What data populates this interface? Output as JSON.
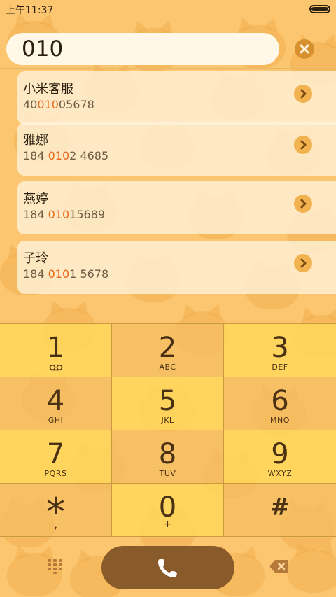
{
  "status": {
    "time": "上午11:37"
  },
  "search": {
    "value": "010"
  },
  "results": [
    {
      "name": "小米客服",
      "num_pre": "40",
      "num_hl": "010",
      "num_post": "05678"
    },
    {
      "name": "雅娜",
      "num_pre": "184 ",
      "num_hl": "010",
      "num_post": "2 4685"
    },
    {
      "name": "燕婷",
      "num_pre": "184 ",
      "num_hl": "010",
      "num_post": "15689"
    },
    {
      "name": "子玲",
      "num_pre": "184 ",
      "num_hl": "010",
      "num_post": "1 5678"
    }
  ],
  "keypad": {
    "k1": {
      "digit": "1",
      "letters": ""
    },
    "k2": {
      "digit": "2",
      "letters": "ABC"
    },
    "k3": {
      "digit": "3",
      "letters": "DEF"
    },
    "k4": {
      "digit": "4",
      "letters": "GHI"
    },
    "k5": {
      "digit": "5",
      "letters": "JKL"
    },
    "k6": {
      "digit": "6",
      "letters": "MNO"
    },
    "k7": {
      "digit": "7",
      "letters": "PQRS"
    },
    "k8": {
      "digit": "8",
      "letters": "TUV"
    },
    "k9": {
      "digit": "9",
      "letters": "WXYZ"
    },
    "kstar": {
      "digit": "*",
      "sub": ","
    },
    "k0": {
      "digit": "0",
      "sub": "+"
    },
    "khash": {
      "digit": "#"
    }
  },
  "icons": {
    "clear": "close-circle-icon",
    "detail": "chevron-right-icon",
    "call": "phone-icon",
    "dialpad": "dialpad-grid-icon",
    "backspace": "backspace-icon",
    "voicemail": "voicemail-icon",
    "battery": "battery-icon"
  },
  "colors": {
    "background": "#fcc56f",
    "highlight": "#e8681c",
    "call_button": "#8a5b2a",
    "key_light": "#ffd75a",
    "key_dark": "#f6be62"
  }
}
